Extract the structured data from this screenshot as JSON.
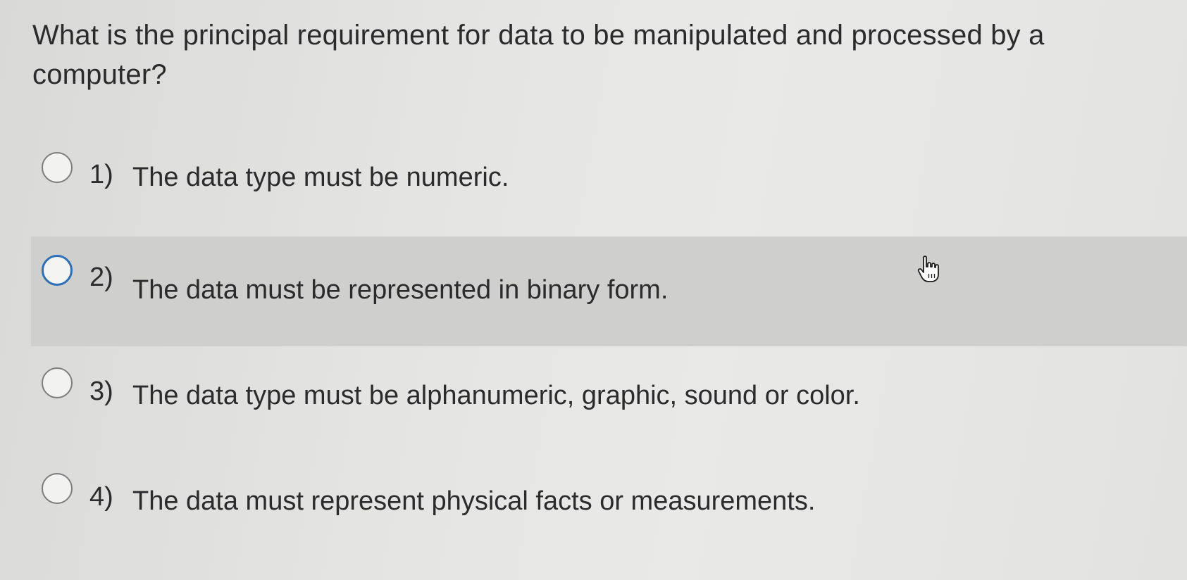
{
  "question": {
    "text": "What is the principal requirement for data to be manipulated and processed by a computer?"
  },
  "options": [
    {
      "number": "1)",
      "text": "The data type must be numeric.",
      "selected": false
    },
    {
      "number": "2)",
      "text": "The data must be represented in binary form.",
      "selected": false,
      "hovered": true
    },
    {
      "number": "3)",
      "text": "The data type must be alphanumeric, graphic, sound or color.",
      "selected": false
    },
    {
      "number": "4)",
      "text": "The data must represent physical facts or measurements.",
      "selected": false
    }
  ],
  "cursor": {
    "icon": "hand-pointer-icon"
  },
  "colors": {
    "hover_background": "#cfcfcd",
    "focus_ring": "#2f6fb5",
    "text": "#2b2b2d"
  }
}
